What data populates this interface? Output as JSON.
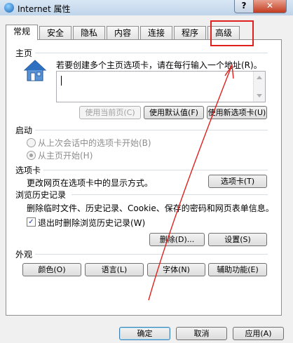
{
  "window": {
    "title": "Internet 属性",
    "help": "?",
    "close": "✕"
  },
  "tabs": [
    {
      "label": "常规",
      "active": true
    },
    {
      "label": "安全"
    },
    {
      "label": "隐私"
    },
    {
      "label": "内容"
    },
    {
      "label": "连接"
    },
    {
      "label": "程序"
    },
    {
      "label": "高级"
    }
  ],
  "home": {
    "label": "主页",
    "description": "若要创建多个主页选项卡，请在每行输入一个地址(R)。",
    "use_current": "使用当前页(C)",
    "use_default": "使用默认值(F)",
    "use_new_tab": "使用新选项卡(U)"
  },
  "startup": {
    "label": "启动",
    "option_last_session": "从上次会话中的选项卡开始(B)",
    "option_home": "从主页开始(H)"
  },
  "tabs_section": {
    "label": "选项卡",
    "description": "更改网页在选项卡中的显示方式。",
    "button": "选项卡(T)"
  },
  "history": {
    "label": "浏览历史记录",
    "description": "删除临时文件、历史记录、Cookie、保存的密码和网页表单信息。",
    "checkbox": "退出时删除浏览历史记录(W)",
    "delete": "删除(D)...",
    "settings": "设置(S)"
  },
  "appearance": {
    "label": "外观",
    "colors": "颜色(O)",
    "languages": "语言(L)",
    "fonts": "字体(N)",
    "accessibility": "辅助功能(E)"
  },
  "footer": {
    "ok": "确定",
    "cancel": "取消",
    "apply": "应用(A)"
  },
  "colors": {
    "annotation": "#e0201d",
    "accent": "#3c7fb1"
  }
}
